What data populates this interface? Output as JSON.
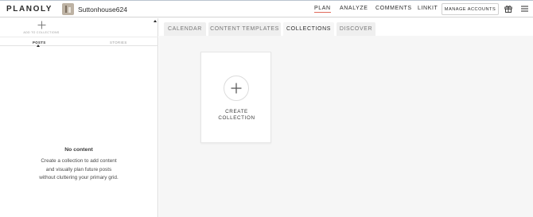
{
  "brand": {
    "logo": "PLANOLY"
  },
  "account": {
    "name": "Suttonhouse624"
  },
  "nav": {
    "items": [
      {
        "label": "PLAN",
        "active": true
      },
      {
        "label": "ANALYZE",
        "active": false
      },
      {
        "label": "COMMENTS",
        "active": false
      },
      {
        "label": "LINKIT",
        "active": false
      }
    ],
    "manage_accounts": "MANAGE ACCOUNTS",
    "icons": [
      "gift-icon",
      "hamburger-menu-icon"
    ]
  },
  "sidebar": {
    "add_label": "ADD TO COLLECTIONS",
    "tabs": [
      {
        "label": "POSTS",
        "active": true
      },
      {
        "label": "STORIES",
        "active": false
      }
    ],
    "empty_title": "No content",
    "empty_lines": [
      "Create a collection to add content",
      "and visually plan future posts",
      "without cluttering your primary grid."
    ]
  },
  "tabs": [
    {
      "label": "CALENDAR",
      "active": false
    },
    {
      "label": "CONTENT TEMPLATES",
      "active": false
    },
    {
      "label": "COLLECTIONS",
      "active": true
    },
    {
      "label": "DISCOVER",
      "active": false
    }
  ],
  "create_card": {
    "line1": "CREATE",
    "line2": "COLLECTION"
  },
  "colors": {
    "accent_underline": "#e06b5c",
    "panel_bg": "#f6f6f6",
    "tab_bg": "#efefef"
  }
}
